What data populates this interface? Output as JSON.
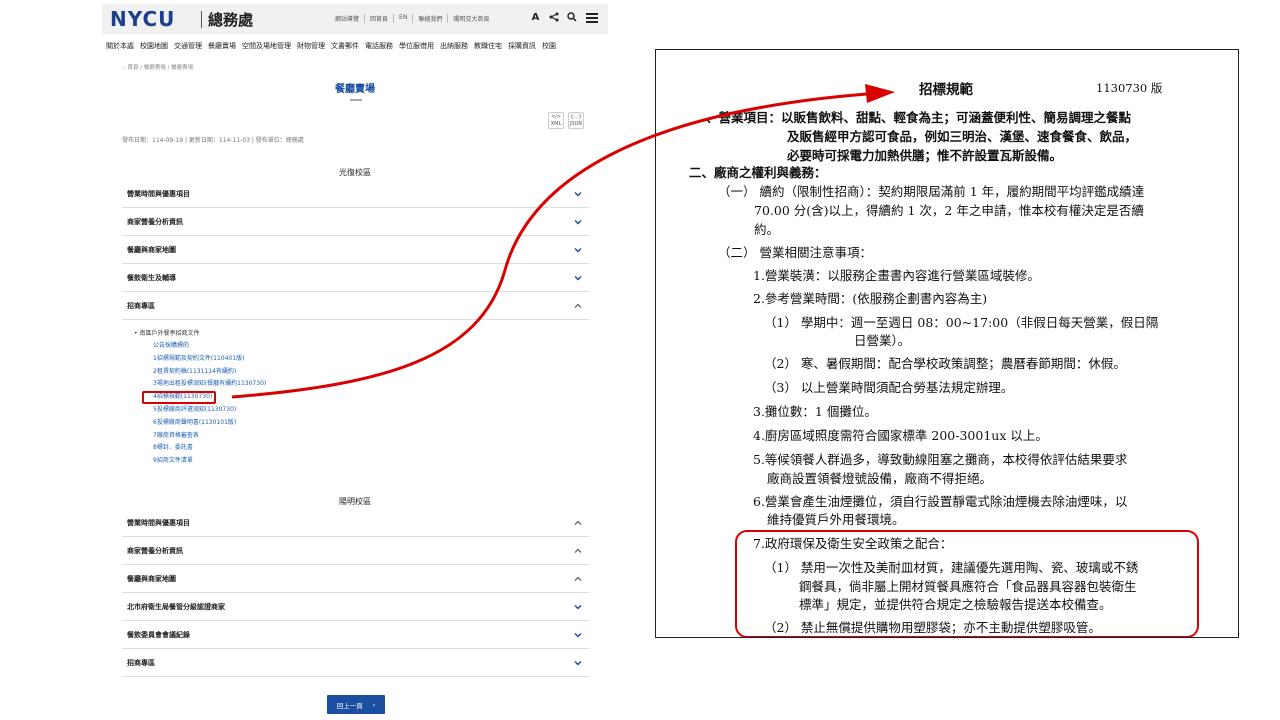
{
  "site": {
    "logo": "NYCU",
    "logo_sub": "總務處",
    "top_links": [
      "網站導覽",
      "回首頁",
      "EN",
      "聯絡我們",
      "陽明交大首頁"
    ],
    "tool_labels": {
      "font": "A"
    },
    "main_nav": [
      "關於本處",
      "校園地圖",
      "交通管理",
      "餐廳賣場",
      "空間及場地管理",
      "財物管理",
      "文書郵件",
      "電話服務",
      "學位服借用",
      "出納服務",
      "教職住宅",
      "採購資訊",
      "校園"
    ],
    "breadcrumb": ":: 首頁 / 餐廳賣場 / 餐廳賣場",
    "page_title": "餐廳賣場",
    "xml_label": "XML",
    "json_label": "JSON",
    "dates": "發布日期：114-09-19 | 更新日期：114-11-03 | 發布單位：總務處",
    "campus1": {
      "title": "光復校區",
      "items": [
        "營業時間與優惠項目",
        "商家營養分析資訊",
        "餐廳與商家地圖",
        "餐飲衛生及輔導",
        "招商專區"
      ]
    },
    "open_section": {
      "bullet": "• 南區戶外餐亭招商文件",
      "links": [
        "公告採購標的",
        "1招標規範及契約文件(110401版)",
        "2租賃契約稿(1131114有續約)",
        "3場地出租投標須知(餐廳有續約1130730)",
        "4招標規範(1130730)",
        "5投標廠商評選須知(1130730)",
        "6投標廠商聲明書(1130101版)",
        "7廠商資格審查表",
        "8標封、委託書",
        "9招商文件清單"
      ]
    },
    "campus2": {
      "title": "陽明校區",
      "items": [
        "營業時間與優惠項目",
        "商家營養分析資訊",
        "餐廳與商家地圖",
        "北市府衛生局餐管分級認證商家",
        "餐飲委員會會議紀錄",
        "招商專區"
      ]
    },
    "back_button": "回上一頁",
    "back_arrow": "›"
  },
  "doc": {
    "title": "招標規範",
    "version": "1130730 版",
    "lines": [
      "、營業項目：以販售飲料、甜點、輕食為主；可涵蓋便利性、簡易調理之餐點",
      "及販售經甲方認可食品，例如三明治、漢堡、速食餐食、飲品，",
      "必要時可採電力加熱供膳；惟不許設置瓦斯設備。",
      "二、廠商之權利與義務：",
      "（一） 續約（限制性招商）：契約期限屆滿前 1 年，履約期間平均評鑑成績達",
      "70.00 分(含)以上，得續約 1 次，2 年之申請，惟本校有權決定是否續",
      "約。",
      "（二） 營業相關注意事項：",
      "1.營業裝潢：以服務企畫書內容進行營業區域裝修。",
      "2.參考營業時間：(依服務企劃書內容為主)",
      "（1） 學期中：週一至週日 08：00~17:00（非假日每天營業，假日隔",
      "日營業）。",
      "（2） 寒、暑假期間：配合學校政策調整；農曆春節期間：休假。",
      "（3） 以上營業時間須配合勞基法規定辦理。",
      "3.攤位數：1 個攤位。",
      "4.廚房區域照度需符合國家標準 200-3001ux 以上。",
      "5.等候領餐人群過多，導致動線阻塞之攤商，本校得依評估結果要求",
      "廠商設置領餐燈號設備，廠商不得拒絕。",
      "6.營業會產生油煙攤位，須自行設置靜電式除油煙機去除油煙味，以",
      "維持優質戶外用餐環境。",
      "7.政府環保及衛生安全政策之配合：",
      "（1） 禁用一次性及美耐皿材質，建議優先選用陶、瓷、玻璃或不銹",
      "鋼餐具，倘非屬上開材質餐具應符合「食品器具容器包裝衛生",
      "標準」規定，並提供符合規定之檢驗報告提送本校備查。",
      "（2） 禁止無償提供購物用塑膠袋；亦不主動提供塑膠吸管。"
    ]
  },
  "colors": {
    "brand": "#1d3f8c",
    "link": "#1d5fb0",
    "highlight": "#d90000"
  }
}
